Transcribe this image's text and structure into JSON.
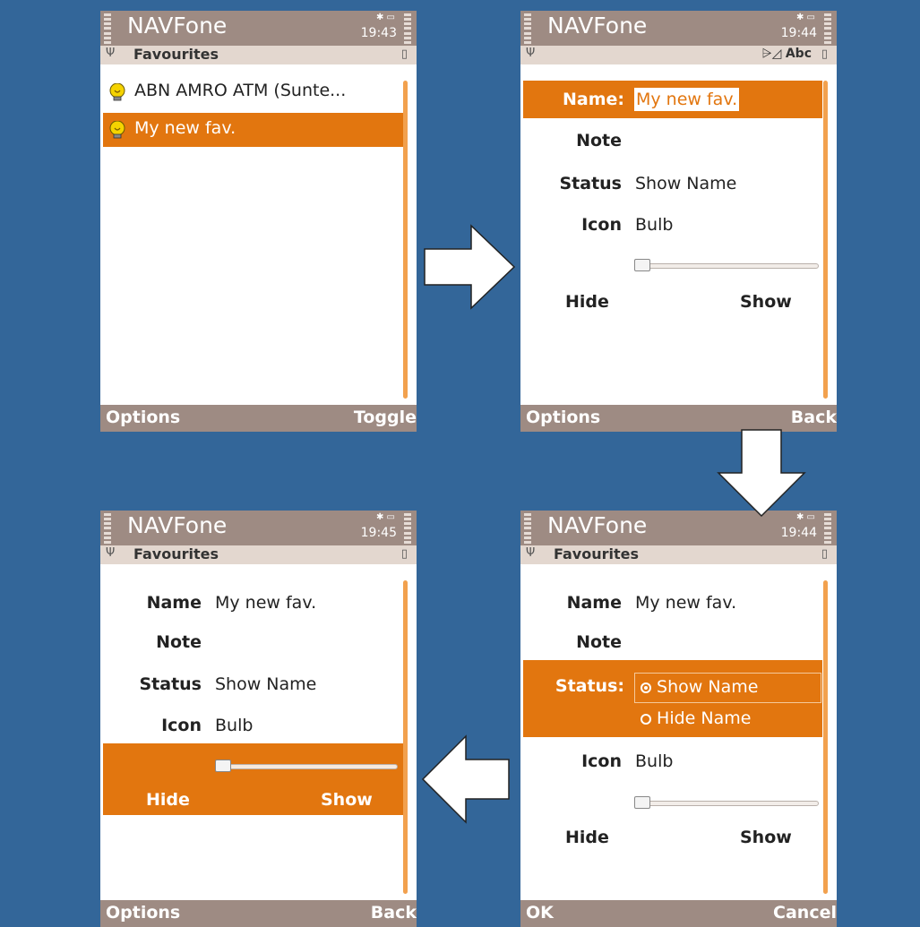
{
  "app_name": "NAVFone",
  "colors": {
    "background": "#336699",
    "highlight": "#e2760f",
    "status_bar": "#9e8b83",
    "sub_bar": "#e3d7cf",
    "scrollbar": "#f2a14e"
  },
  "screens": {
    "s1": {
      "time": "19:43",
      "title": "Favourites",
      "items": [
        {
          "label": "ABN AMRO ATM (Sunte...",
          "icon": "bulb-icon"
        },
        {
          "label": "My new fav.",
          "icon": "bulb-icon"
        }
      ],
      "left_soft": "Options",
      "right_soft": "Toggle"
    },
    "s2": {
      "time": "19:44",
      "input_mode": "Abc",
      "fields": {
        "name_label": "Name:",
        "name_value": "My new fav.",
        "note_label": "Note",
        "status_label": "Status",
        "status_value": "Show Name",
        "icon_label": "Icon",
        "icon_value": "Bulb"
      },
      "slider": {
        "min_label": "Hide",
        "max_label": "Show",
        "value": 0
      },
      "left_soft": "Options",
      "right_soft": "Back"
    },
    "s3": {
      "time": "19:44",
      "title": "Favourites",
      "fields": {
        "name_label": "Name",
        "name_value": "My new fav.",
        "note_label": "Note",
        "status_label": "Status:",
        "icon_label": "Icon",
        "icon_value": "Bulb"
      },
      "radio_options": [
        "Show Name",
        "Hide Name"
      ],
      "radio_selected": "Show Name",
      "slider": {
        "min_label": "Hide",
        "max_label": "Show",
        "value": 0
      },
      "left_soft": "OK",
      "right_soft": "Cancel"
    },
    "s4": {
      "time": "19:45",
      "title": "Favourites",
      "fields": {
        "name_label": "Name",
        "name_value": "My new fav.",
        "note_label": "Note",
        "status_label": "Status",
        "status_value": "Show Name",
        "icon_label": "Icon",
        "icon_value": "Bulb"
      },
      "slider": {
        "min_label": "Hide",
        "max_label": "Show",
        "value": 0
      },
      "left_soft": "Options",
      "right_soft": "Back"
    }
  }
}
